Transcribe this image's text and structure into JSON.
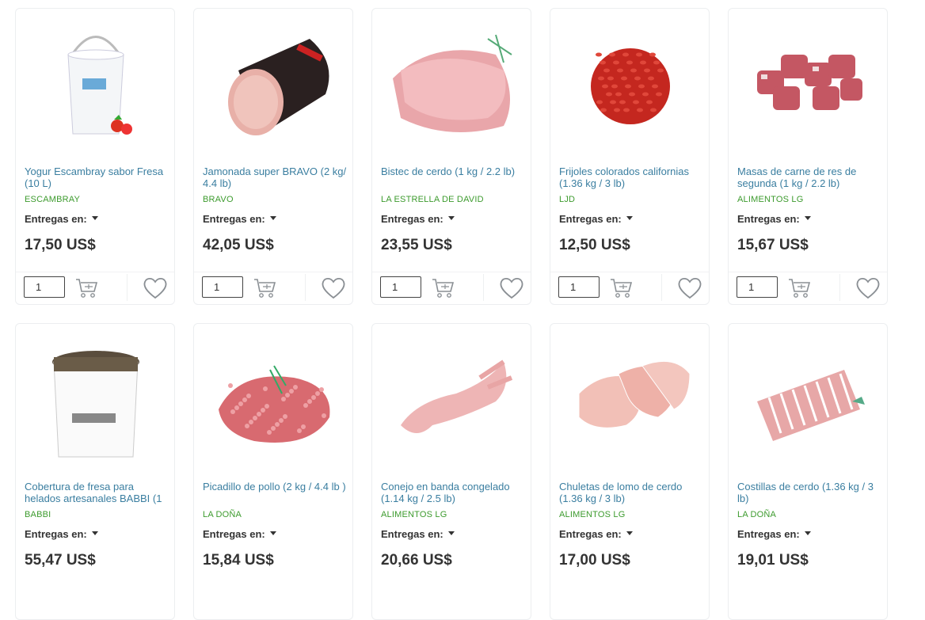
{
  "delivery_label": "Entregas en:",
  "products": [
    {
      "title": "Yogur Escambray sabor Fresa (10 L)",
      "brand": "ESCAMBRAY",
      "price": "17,50 US$",
      "qty": "1",
      "image": "bucket-yogurt-icon"
    },
    {
      "title": "Jamonada super BRAVO (2 kg/ 4.4 lb)",
      "brand": "BRAVO",
      "price": "42,05 US$",
      "qty": "1",
      "image": "ham-roll-icon"
    },
    {
      "title": "Bistec de cerdo (1 kg / 2.2 lb)",
      "brand": "LA ESTRELLA DE DAVID",
      "price": "23,55 US$",
      "qty": "1",
      "image": "pork-steak-icon"
    },
    {
      "title": "Frijoles colorados californias (1.36 kg / 3 lb)",
      "brand": "LJD",
      "price": "12,50 US$",
      "qty": "1",
      "image": "red-beans-icon"
    },
    {
      "title": "Masas de carne de res de segunda (1 kg / 2.2 lb)",
      "brand": "ALIMENTOS LG",
      "price": "15,67 US$",
      "qty": "1",
      "image": "beef-chunks-icon"
    },
    {
      "title": "Cobertura de fresa para helados artesanales BABBI (1",
      "brand": "BABBI",
      "price": "55,47 US$",
      "qty": "",
      "image": "topping-bucket-icon"
    },
    {
      "title": "Picadillo de pollo (2 kg / 4.4 lb )",
      "brand": "LA DOÑA",
      "price": "15,84 US$",
      "qty": "",
      "image": "ground-chicken-icon"
    },
    {
      "title": "Conejo en banda congelado (1.14 kg / 2.5 lb)",
      "brand": "ALIMENTOS LG",
      "price": "20,66 US$",
      "qty": "",
      "image": "rabbit-meat-icon"
    },
    {
      "title": "Chuletas de lomo de cerdo (1.36 kg / 3 lb)",
      "brand": "ALIMENTOS LG",
      "price": "17,00 US$",
      "qty": "",
      "image": "pork-chops-icon"
    },
    {
      "title": "Costillas de cerdo (1.36 kg / 3 lb)",
      "brand": "LA DOÑA",
      "price": "19,01 US$",
      "qty": "",
      "image": "pork-ribs-icon"
    }
  ],
  "colors": {
    "title": "#3a7ea0",
    "brand": "#3d9b2e",
    "price": "#333333",
    "border": "#eceef0"
  }
}
